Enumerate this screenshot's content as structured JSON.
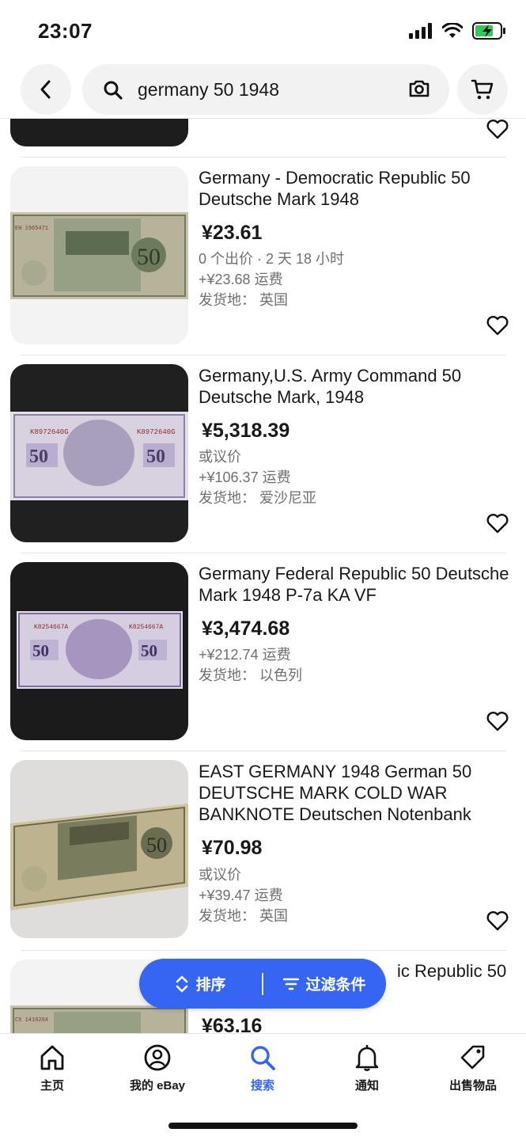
{
  "status": {
    "time": "23:07"
  },
  "search": {
    "query": "germany 50 1948"
  },
  "items": [
    {
      "title": "Germany - Democratic Republic 50 Deutsche Mark 1948",
      "price": "¥23.61",
      "meta1": "0 个出价 · 2 天 18 小时",
      "meta2": "+¥23.68 运费",
      "meta3": "发货地：  英国"
    },
    {
      "title": "Germany,U.S. Army Command 50 Deutsche Mark, 1948",
      "price": "¥5,318.39",
      "meta1": "或议价",
      "meta2": "+¥106.37 运费",
      "meta3": "发货地：  爱沙尼亚"
    },
    {
      "title": "Germany Federal Republic 50 Deutsche Mark 1948 P-7a  KA  VF",
      "price": "¥3,474.68",
      "meta1": "+¥212.74 运费",
      "meta2": "发货地：  以色列"
    },
    {
      "title": "EAST GERMANY 1948 German 50 DEUTSCHE MARK COLD WAR BANKNOTE Deutschen Notenbank",
      "price": "¥70.98",
      "meta1": "或议价",
      "meta2": "+¥39.47 运费",
      "meta3": "发货地：  英国"
    },
    {
      "title": "ic Republic 50",
      "price": "¥63.16"
    }
  ],
  "float_bar": {
    "sort": "排序",
    "filter": "过滤条件"
  },
  "nav": {
    "home": "主页",
    "my_ebay": "我的 eBay",
    "search": "搜索",
    "notifications": "通知",
    "selling": "出售物品"
  },
  "colors": {
    "accent": "#3665f3",
    "text": "#191919",
    "secondary": "#707070"
  }
}
